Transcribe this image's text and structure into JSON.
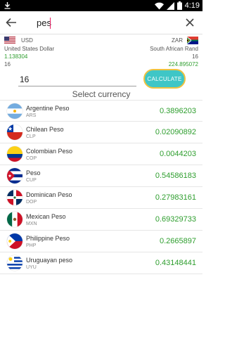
{
  "status_bar": {
    "time": "4:19"
  },
  "search": {
    "query": "pes"
  },
  "conversion": {
    "from": {
      "code": "USD",
      "name": "United States Dollar",
      "rate": "1.138304",
      "amount": "16"
    },
    "to": {
      "code": "ZAR",
      "name": "South African Rand",
      "amount": "16",
      "result": "224.895072"
    }
  },
  "amount_input": {
    "value": "16"
  },
  "calculate_label": "CALCULATE",
  "select_title": "Select currency",
  "currencies": [
    {
      "name": "Argentine Peso",
      "code": "ARS",
      "rate": "0.3896203",
      "flag": "argentina-flag"
    },
    {
      "name": "Chilean Peso",
      "code": "CLP",
      "rate": "0.02090892",
      "flag": "chile-flag"
    },
    {
      "name": "Colombian Peso",
      "code": "COP",
      "rate": "0.0044203",
      "flag": "colombia-flag"
    },
    {
      "name": "Peso",
      "code": "CUP",
      "rate": "0.54586183",
      "flag": "cuba-flag"
    },
    {
      "name": "Dominican Peso",
      "code": "DOP",
      "rate": "0.27983161",
      "flag": "dominican-republic-flag"
    },
    {
      "name": "Mexican Peso",
      "code": "MXN",
      "rate": "0.69329733",
      "flag": "mexico-flag"
    },
    {
      "name": "Philippine Peso",
      "code": "PHP",
      "rate": "0.2665897",
      "flag": "philippines-flag"
    },
    {
      "name": "Uruguayan peso",
      "code": "UYU",
      "rate": "0.43148441",
      "flag": "uruguay-flag"
    }
  ],
  "colors": {
    "accent": "#3fc6c6",
    "accent_border": "#f0c240",
    "value_green": "#2e9e2e",
    "cursor": "#e91e63"
  }
}
